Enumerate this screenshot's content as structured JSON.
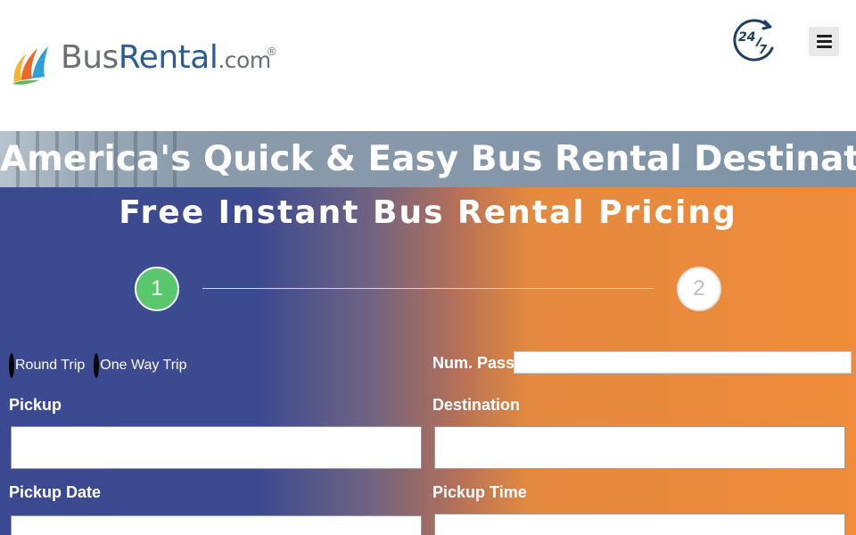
{
  "header": {
    "logo": {
      "part1": "Bus",
      "part2": "Rental",
      "part3": ".com",
      "reg": "®"
    },
    "badge_text": {
      "top": "24",
      "bottom": "7"
    },
    "menu_icon": "hamburger-menu-icon"
  },
  "hero": {
    "title": "America's Quick & Easy Bus Rental Destination"
  },
  "form": {
    "title": "Free Instant Bus Rental Pricing",
    "steps": [
      {
        "number": "1",
        "state": "active",
        "color": "#5bc76c"
      },
      {
        "number": "2",
        "state": "inactive"
      }
    ],
    "trip_type": {
      "options": [
        "Round Trip",
        "One Way Trip"
      ]
    },
    "fields": {
      "num_pass": {
        "label": "Num. Pass",
        "value": ""
      },
      "pickup": {
        "label": "Pickup",
        "value": ""
      },
      "destination": {
        "label": "Destination",
        "value": ""
      },
      "pickup_date": {
        "label": "Pickup Date",
        "value": ""
      },
      "pickup_time": {
        "label": "Pickup Time",
        "value": ""
      }
    }
  },
  "colors": {
    "gradient_left": "#3b4990",
    "gradient_right": "#ef8b39",
    "brand_blue": "#2a5c9a",
    "brand_gray": "#6b6f75",
    "step_active": "#5bc76c"
  }
}
